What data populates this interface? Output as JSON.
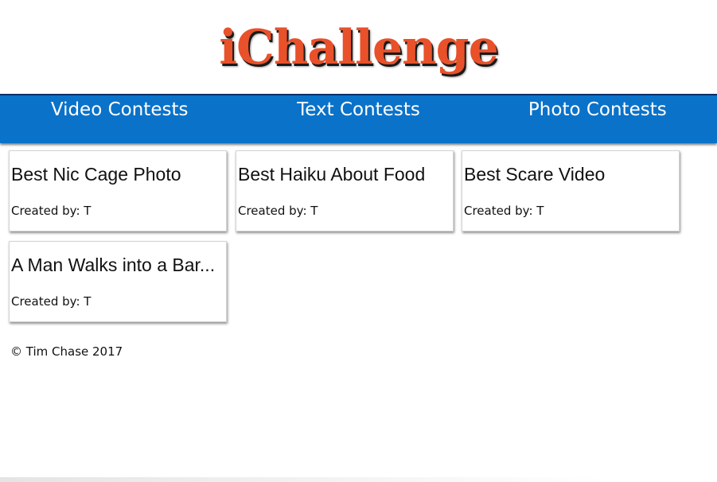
{
  "brand": {
    "logo_text": "iChallenge",
    "logo_color": "#e8512a"
  },
  "nav": {
    "background": "#0a72c9",
    "items": [
      {
        "label": "Video Contests"
      },
      {
        "label": "Text Contests"
      },
      {
        "label": "Photo Contests"
      }
    ]
  },
  "contests": [
    {
      "title": "Best Nic Cage Photo",
      "created_by": "Created by: T"
    },
    {
      "title": "Best Haiku About Food",
      "created_by": "Created by: T"
    },
    {
      "title": "Best Scare Video",
      "created_by": "Created by: T"
    },
    {
      "title": "A Man Walks into a Bar...",
      "created_by": "Created by: T"
    }
  ],
  "footer": {
    "copyright": "© Tim Chase 2017"
  }
}
